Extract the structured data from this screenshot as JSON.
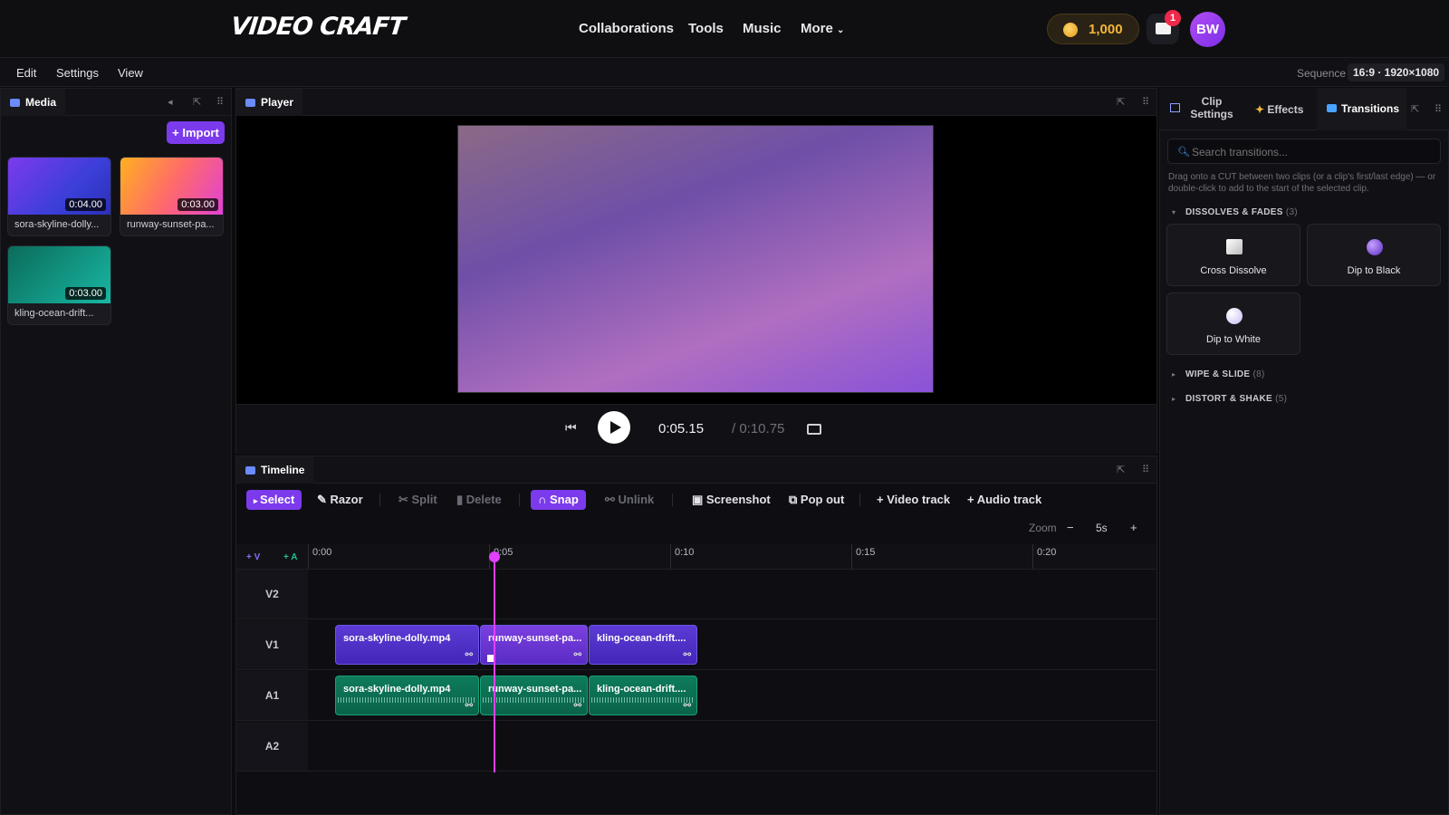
{
  "app": {
    "logo": "VIDEO CRAFT"
  },
  "nav": {
    "collaborations": "Collaborations",
    "tools": "Tools",
    "music": "Music",
    "more": "More"
  },
  "account": {
    "coins": "1,000",
    "notifications": "1",
    "avatar_initials": "BW"
  },
  "menu": {
    "edit": "Edit",
    "settings": "Settings",
    "view": "View"
  },
  "sequence": {
    "label": "Sequence",
    "value": "16:9 · 1920×1080"
  },
  "media": {
    "tab": "Media",
    "import_label": "+ Import",
    "items": [
      {
        "name": "sora-skyline-dolly...",
        "duration": "0:04.00"
      },
      {
        "name": "runway-sunset-pa...",
        "duration": "0:03.00"
      },
      {
        "name": "kling-ocean-drift...",
        "duration": "0:03.00"
      }
    ]
  },
  "player": {
    "tab": "Player",
    "current_time": "0:05.15",
    "total_time": "/ 0:10.75"
  },
  "timeline": {
    "tab": "Timeline",
    "tools": {
      "select": "Select",
      "razor": "Razor",
      "split": "Split",
      "delete": "Delete",
      "snap": "Snap",
      "unlink": "Unlink",
      "screenshot": "Screenshot",
      "popout": "Pop out",
      "add_video": "+ Video track",
      "add_audio": "+ Audio track"
    },
    "zoom": {
      "label": "Zoom",
      "value": "5s",
      "minus": "−",
      "plus": "+"
    },
    "add_v": "+ V",
    "add_a": "+ A",
    "ticks": [
      "0:00",
      "0:05",
      "0:10",
      "0:15",
      "0:20"
    ],
    "playhead_seconds": 5.15,
    "tracks": [
      "V2",
      "V1",
      "A1",
      "A2"
    ],
    "clips": {
      "v1": [
        "sora-skyline-dolly.mp4",
        "runway-sunset-pa...",
        "kling-ocean-drift...."
      ],
      "a1": [
        "sora-skyline-dolly.mp4",
        "runway-sunset-pa...",
        "kling-ocean-drift...."
      ]
    }
  },
  "right_panel": {
    "tabs": {
      "clip_settings": "Clip Settings",
      "effects": "Effects",
      "transitions": "Transitions"
    },
    "search_placeholder": "Search transitions...",
    "hint": "Drag onto a CUT between two clips (or a clip's first/last edge) — or double-click to add to the start of the selected clip.",
    "sections": [
      {
        "title": "DISSOLVES & FADES",
        "count": "(3)"
      },
      {
        "title": "WIPE & SLIDE",
        "count": "(8)"
      },
      {
        "title": "DISTORT & SHAKE",
        "count": "(5)"
      }
    ],
    "transitions": [
      "Cross Dissolve",
      "Dip to Black",
      "Dip to White"
    ]
  }
}
